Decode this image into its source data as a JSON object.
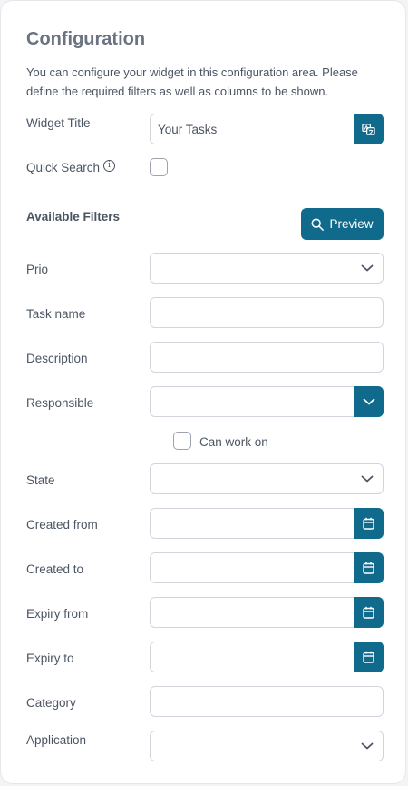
{
  "header": {
    "title": "Configuration",
    "description": "You can configure your widget in this configuration area. Please define the required filters as well as columns to be shown."
  },
  "widget_title": {
    "label": "Widget Title",
    "value": "Your Tasks",
    "translate_icon": "translate-icon"
  },
  "quick_search": {
    "label": "Quick Search",
    "info_icon": "info-icon",
    "checked": false
  },
  "filters": {
    "section_label": "Available Filters",
    "preview_label": "Preview",
    "prio_label": "Prio",
    "task_name_label": "Task name",
    "description_label": "Description",
    "responsible_label": "Responsible",
    "can_work_on_label": "Can work on",
    "state_label": "State",
    "created_from_label": "Created from",
    "created_to_label": "Created to",
    "expiry_from_label": "Expiry from",
    "expiry_to_label": "Expiry to",
    "category_label": "Category",
    "application_label": "Application"
  },
  "colors": {
    "accent": "#0f6a8b",
    "border": "#d1d5db",
    "text": "#4b5563"
  }
}
